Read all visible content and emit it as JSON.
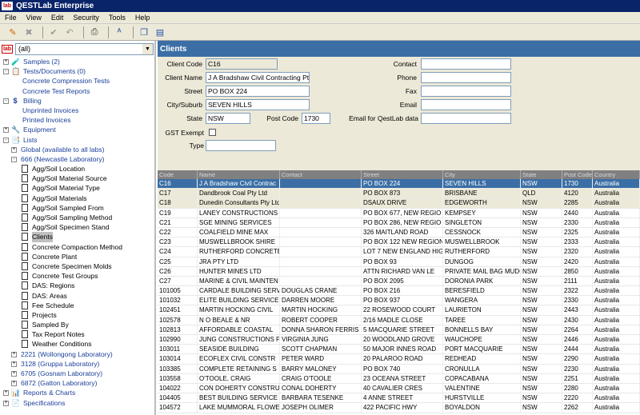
{
  "app": {
    "logo": "lab",
    "title": "QESTLab Enterprise"
  },
  "menu": [
    "File",
    "View",
    "Edit",
    "Security",
    "Tools",
    "Help"
  ],
  "toolbar": {
    "icons": [
      "new-record-icon",
      "delete-icon",
      "check-icon",
      "undo-icon",
      "print-icon",
      "spellcheck-icon",
      "copy-icon",
      "paste-icon"
    ]
  },
  "lab_select": {
    "logo": "lab",
    "value": "(all)"
  },
  "tree": [
    {
      "label": "Samples (2)",
      "level": 0,
      "exp": "+",
      "icon": "samples-icon",
      "glyph": "🧪",
      "blue": true
    },
    {
      "label": "Tests/Documents (0)",
      "level": 0,
      "exp": "-",
      "icon": "tests-icon",
      "glyph": "📋",
      "blue": true
    },
    {
      "label": "Concrete Compression Tests",
      "level": 2,
      "blue": true
    },
    {
      "label": "Concrete Test Reports",
      "level": 2,
      "blue": true
    },
    {
      "label": "Billing",
      "level": 0,
      "exp": "-",
      "icon": "billing-icon",
      "glyph": "$",
      "blue": true
    },
    {
      "label": "Unprinted Invoices",
      "level": 2,
      "blue": true
    },
    {
      "label": "Printed Invoices",
      "level": 2,
      "blue": true
    },
    {
      "label": "Equipment",
      "level": 0,
      "exp": "+",
      "icon": "equipment-icon",
      "glyph": "🔧",
      "blue": true
    },
    {
      "label": "Lists",
      "level": 0,
      "exp": "-",
      "icon": "lists-icon",
      "glyph": "📑",
      "blue": true
    },
    {
      "label": "Global (available to all labs)",
      "level": 1,
      "exp": "+",
      "blue": true
    },
    {
      "label": "666 (Newcastle Laboratory)",
      "level": 1,
      "exp": "-",
      "blue": true
    },
    {
      "label": "Agg/Soil Location",
      "level": 2,
      "doc": true
    },
    {
      "label": "Agg/Soil Material Source",
      "level": 2,
      "doc": true
    },
    {
      "label": "Agg/Soil Material Type",
      "level": 2,
      "doc": true
    },
    {
      "label": "Agg/Soil Materials",
      "level": 2,
      "doc": true
    },
    {
      "label": "Agg/Soil Sampled From",
      "level": 2,
      "doc": true
    },
    {
      "label": "Agg/Soil Sampling Method",
      "level": 2,
      "doc": true
    },
    {
      "label": "Agg/Soil Specimen Stand",
      "level": 2,
      "doc": true
    },
    {
      "label": "Clients",
      "level": 2,
      "doc": true,
      "selected": true
    },
    {
      "label": "Concrete Compaction Method",
      "level": 2,
      "doc": true
    },
    {
      "label": "Concrete Plant",
      "level": 2,
      "doc": true
    },
    {
      "label": "Concrete Specimen Molds",
      "level": 2,
      "doc": true
    },
    {
      "label": "Concrete Test Groups",
      "level": 2,
      "doc": true
    },
    {
      "label": "DAS: Regions",
      "level": 2,
      "doc": true
    },
    {
      "label": "DAS: Areas",
      "level": 2,
      "doc": true
    },
    {
      "label": "Fee Schedule",
      "level": 2,
      "doc": true
    },
    {
      "label": "Projects",
      "level": 2,
      "doc": true
    },
    {
      "label": "Sampled By",
      "level": 2,
      "doc": true
    },
    {
      "label": "Tax Report Notes",
      "level": 2,
      "doc": true
    },
    {
      "label": "Weather Conditions",
      "level": 2,
      "doc": true
    },
    {
      "label": "2221 (Wollongong Laboratory)",
      "level": 1,
      "exp": "+",
      "blue": true
    },
    {
      "label": "3128 (Gruppa Laboratory)",
      "level": 1,
      "exp": "+",
      "blue": true
    },
    {
      "label": "6705 (Gosnam Laboratory)",
      "level": 1,
      "exp": "+",
      "blue": true
    },
    {
      "label": "6872 (Gatton Laboratory)",
      "level": 1,
      "exp": "+",
      "blue": true
    },
    {
      "label": "Reports & Charts",
      "level": 0,
      "exp": "+",
      "icon": "reports-icon",
      "glyph": "📊",
      "blue": true
    },
    {
      "label": "Specifications",
      "level": 0,
      "exp": "+",
      "icon": "specifications-icon",
      "glyph": "📄",
      "blue": true
    }
  ],
  "panel": {
    "title": "Clients"
  },
  "form": {
    "client_code_label": "Client Code",
    "client_code": "C16",
    "client_name_label": "Client Name",
    "client_name": "J A Bradshaw Civil Contracting Pty Ltd",
    "street_label": "Street",
    "street": "PO BOX 224",
    "suburb_label": "City/Suburb",
    "suburb": "SEVEN HILLS",
    "state_label": "State",
    "state": "NSW",
    "postcode_label": "Post Code",
    "postcode": "1730",
    "gst_label": "GST Exempt",
    "type_label": "Type",
    "type": "",
    "contact_label": "Contact",
    "contact": "",
    "phone_label": "Phone",
    "phone": "",
    "fax_label": "Fax",
    "fax": "",
    "email_label": "Email",
    "email": "",
    "email_qestlab_label": "Email for QestLab data",
    "email_qestlab": ""
  },
  "grid": {
    "columns": [
      "Code",
      "Name",
      "Contact",
      "Street",
      "City",
      "State",
      "Post Code",
      "Country"
    ],
    "rows": [
      [
        "C16",
        "J A Bradshaw Civil Contrac",
        "",
        "PO BOX 224",
        "SEVEN HILLS",
        "NSW",
        "1730",
        "Australia"
      ],
      [
        "C17",
        "Dandbrook Coal Pty Ltd",
        "",
        "PO BOX 873",
        "BRISBANE",
        "QLD",
        "4120",
        "Australia"
      ],
      [
        "C18",
        "Dunedin Consultants Pty Ltd",
        "",
        "DSAUX DRIVE",
        "EDGEWORTH",
        "NSW",
        "2285",
        "Australia"
      ],
      [
        "C19",
        "LANEY CONSTRUCTIONS",
        "",
        "PO BOX 677, NEW REGIO",
        "KEMPSEY",
        "NSW",
        "2440",
        "Australia"
      ],
      [
        "C21",
        "SGE MINING SERVICES",
        "",
        "PO BOX 286, NEW REGIO",
        "SINGLETON",
        "NSW",
        "2330",
        "Australia"
      ],
      [
        "C22",
        "COALFIELD MINE MAX",
        "",
        "326 MAITLAND ROAD",
        "CESSNOCK",
        "NSW",
        "2325",
        "Australia"
      ],
      [
        "C23",
        "MUSWELLBROOK SHIRE",
        "",
        "PO BOX 122 NEW REGION",
        "MUSWELLBROOK",
        "NSW",
        "2333",
        "Australia"
      ],
      [
        "C24",
        "RUTHERFORD CONCRETE",
        "",
        "LOT 7 NEW ENGLAND HIG",
        "RUTHERFORD",
        "NSW",
        "2320",
        "Australia"
      ],
      [
        "C25",
        "JRA PTY LTD",
        "",
        "PO BOX 93",
        "DUNGOG",
        "NSW",
        "2420",
        "Australia"
      ],
      [
        "C26",
        "HUNTER MINES LTD",
        "",
        "ATTN RICHARD VAN LE",
        "PRIVATE MAIL BAG MUDG",
        "NSW",
        "2850",
        "Australia"
      ],
      [
        "C27",
        "MARINE & CIVIL MAINTEN",
        "",
        "PO BOX 2095",
        "DORONIA PARK",
        "NSW",
        "2111",
        "Australia"
      ],
      [
        "101005",
        "CARDALE BUILDING SERV",
        "DOUGLAS CRANE",
        "PO BOX 216",
        "BERESFIELD",
        "NSW",
        "2322",
        "Australia"
      ],
      [
        "101032",
        "ELITE BUILDING SERVICE",
        "DARREN MOORE",
        "PO BOX 937",
        "WANGERA",
        "NSW",
        "2330",
        "Australia"
      ],
      [
        "102451",
        "MARTIN HOCKING CIVIL",
        "MARTIN HOCKING",
        "22 ROSEWOOD COURT",
        "LAURIETON",
        "NSW",
        "2443",
        "Australia"
      ],
      [
        "102578",
        "N O BEALE & NR",
        "ROBERT COOPER",
        "2/16 MADLE CLOSE",
        "TAREE",
        "NSW",
        "2430",
        "Australia"
      ],
      [
        "102813",
        "AFFORDABLE COASTAL",
        "DONNA SHARON FERRIS",
        "5 MACQUARIE STREET",
        "BONNELLS BAY",
        "NSW",
        "2264",
        "Australia"
      ],
      [
        "102990",
        "JUNG CONSTRUCTIONS PT",
        "VIRGINIA JUNG",
        "20 WOODLAND GROVE",
        "WAUCHOPE",
        "NSW",
        "2446",
        "Australia"
      ],
      [
        "103011",
        "SEASIDE BUILDING",
        "SCOTT CHAPMAN",
        "50 MAJOR INNES ROAD",
        "PORT MACQUARIE",
        "NSW",
        "2444",
        "Australia"
      ],
      [
        "103014",
        "ECOFLEX CIVIL CONSTR",
        "PETER WARD",
        "20 PALAROO ROAD",
        "REDHEAD",
        "NSW",
        "2290",
        "Australia"
      ],
      [
        "103385",
        "COMPLETE RETAINING S",
        "BARRY MALONEY",
        "PO BOX 740",
        "CRONULLA",
        "NSW",
        "2230",
        "Australia"
      ],
      [
        "103558",
        "O'TOOLE, CRAIG",
        "CRAIG O'TOOLE",
        "23 OCEANA STREET",
        "COPACABANA",
        "NSW",
        "2251",
        "Australia"
      ],
      [
        "104022",
        "CON DOHERTY CONSTRU",
        "CONAL DOHERTY",
        "40 CAVALIER CRES",
        "VALENTINE",
        "NSW",
        "2280",
        "Australia"
      ],
      [
        "104405",
        "BEST BUILDING SERVICE",
        "BARBARA TESENKE",
        "4 ANNE STREET",
        "HURSTVILLE",
        "NSW",
        "2220",
        "Australia"
      ],
      [
        "104572",
        "LAKE MUMMORAL FLOWE",
        "JOSEPH OLIMER",
        "422 PACIFIC HWY",
        "BOYALDON",
        "NSW",
        "2262",
        "Australia"
      ]
    ]
  }
}
